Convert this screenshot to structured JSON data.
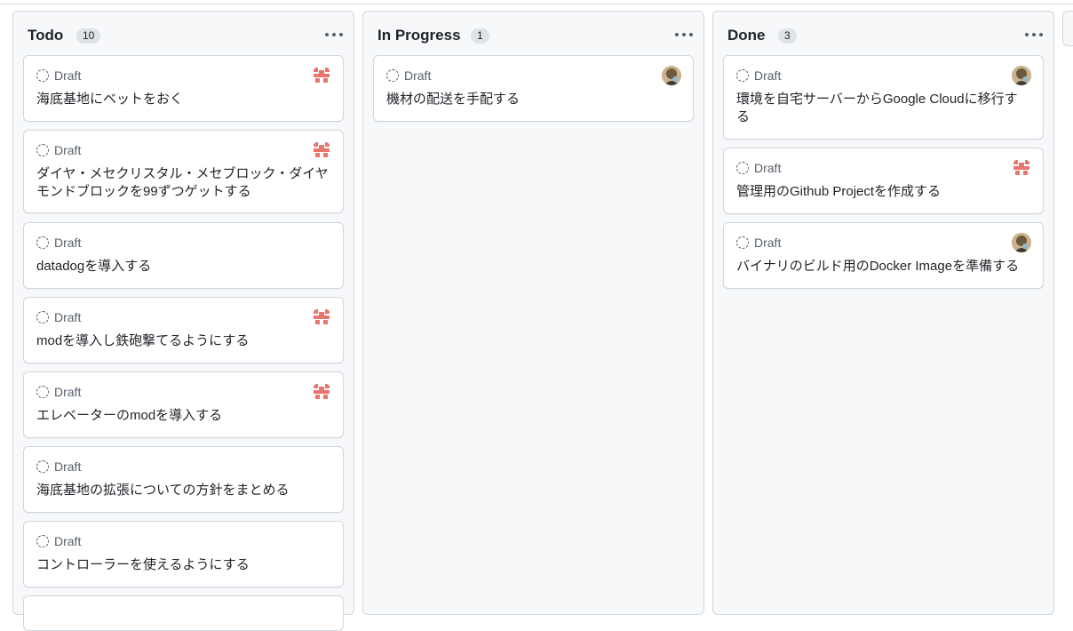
{
  "columns": [
    {
      "title": "Todo",
      "count": "10",
      "cards": [
        {
          "status": "Draft",
          "title": "海底基地にベットをおく",
          "avatar": "identicon"
        },
        {
          "status": "Draft",
          "title": "ダイヤ・メセクリスタル・メセブロック・ダイヤモンドブロックを99ずつゲットする",
          "avatar": "identicon"
        },
        {
          "status": "Draft",
          "title": "datadogを導入する",
          "avatar": "none"
        },
        {
          "status": "Draft",
          "title": "modを導入し鉄砲撃てるようにする",
          "avatar": "identicon"
        },
        {
          "status": "Draft",
          "title": "エレベーターのmodを導入する",
          "avatar": "identicon"
        },
        {
          "status": "Draft",
          "title": "海底基地の拡張についての方針をまとめる",
          "avatar": "none"
        },
        {
          "status": "Draft",
          "title": "コントローラーを使えるようにする",
          "avatar": "none"
        }
      ]
    },
    {
      "title": "In Progress",
      "count": "1",
      "cards": [
        {
          "status": "Draft",
          "title": "機材の配送を手配する",
          "avatar": "photo"
        }
      ]
    },
    {
      "title": "Done",
      "count": "3",
      "cards": [
        {
          "status": "Draft",
          "title": "環境を自宅サーバーからGoogle Cloudに移行する",
          "avatar": "photo"
        },
        {
          "status": "Draft",
          "title": "管理用のGithub Projectを作成する",
          "avatar": "identicon"
        },
        {
          "status": "Draft",
          "title": "バイナリのビルド用のDocker Imageを準備する",
          "avatar": "photo"
        }
      ]
    }
  ],
  "icons": {
    "column_menu": "kebab-horizontal-icon",
    "draft_status": "draft-circle-icon",
    "assignee": "avatar"
  },
  "colors": {
    "identicon": "#e8766f",
    "photo_avatar": "#6b5a3e"
  }
}
